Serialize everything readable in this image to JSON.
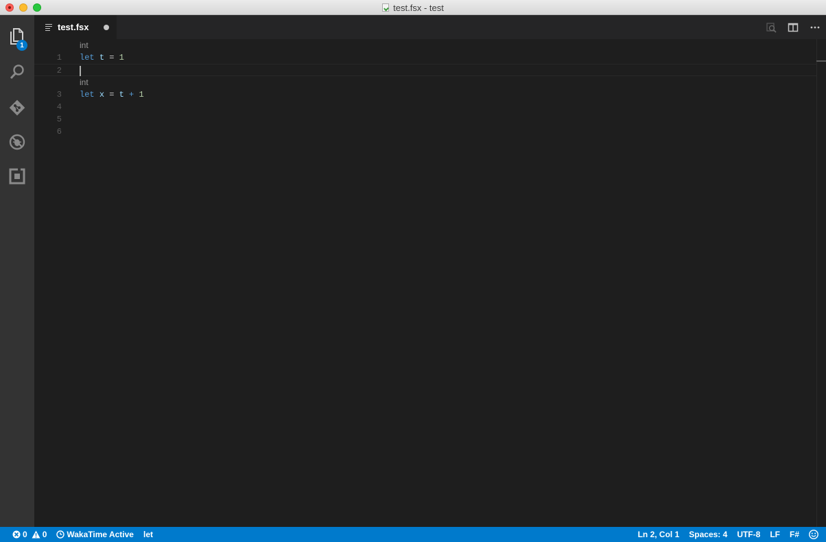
{
  "window": {
    "title": "test.fsx - test"
  },
  "activity_bar": {
    "items": [
      {
        "name": "explorer",
        "icon": "files-icon",
        "badge": "1"
      },
      {
        "name": "search",
        "icon": "search-icon"
      },
      {
        "name": "git",
        "icon": "git-icon"
      },
      {
        "name": "debug",
        "icon": "debug-icon"
      },
      {
        "name": "extensions",
        "icon": "extensions-icon"
      }
    ]
  },
  "tabs": [
    {
      "label": "test.fsx",
      "dirty": true
    }
  ],
  "editor": {
    "lines": [
      {
        "number": "1",
        "lens": "int",
        "tokens": [
          [
            "kw",
            "let"
          ],
          [
            "op",
            " "
          ],
          [
            "ident",
            "t"
          ],
          [
            "op",
            " = "
          ],
          [
            "num",
            "1"
          ]
        ]
      },
      {
        "number": "2",
        "lens": "",
        "tokens": [],
        "current": true
      },
      {
        "number": "3",
        "lens": "int",
        "tokens": [
          [
            "kw",
            "let"
          ],
          [
            "op",
            " "
          ],
          [
            "ident",
            "x"
          ],
          [
            "op",
            " = "
          ],
          [
            "ident",
            "t"
          ],
          [
            "op",
            " "
          ],
          [
            "kw",
            "+"
          ],
          [
            "op",
            " "
          ],
          [
            "num",
            "1"
          ]
        ]
      },
      {
        "number": "4",
        "lens": "",
        "tokens": []
      },
      {
        "number": "5",
        "lens": "",
        "tokens": []
      },
      {
        "number": "6",
        "lens": "",
        "tokens": []
      }
    ]
  },
  "statusbar": {
    "errors": "0",
    "warnings": "0",
    "wakatime": "WakaTime Active",
    "symbol": "let",
    "position": "Ln 2, Col 1",
    "spaces": "Spaces: 4",
    "encoding": "UTF-8",
    "eol": "LF",
    "language": "F#",
    "feedback_icon": "smiley-icon"
  },
  "colors": {
    "accent": "#007acc",
    "keyword": "#569cd6",
    "identifier": "#9cdcfe",
    "number": "#b5cea8"
  }
}
